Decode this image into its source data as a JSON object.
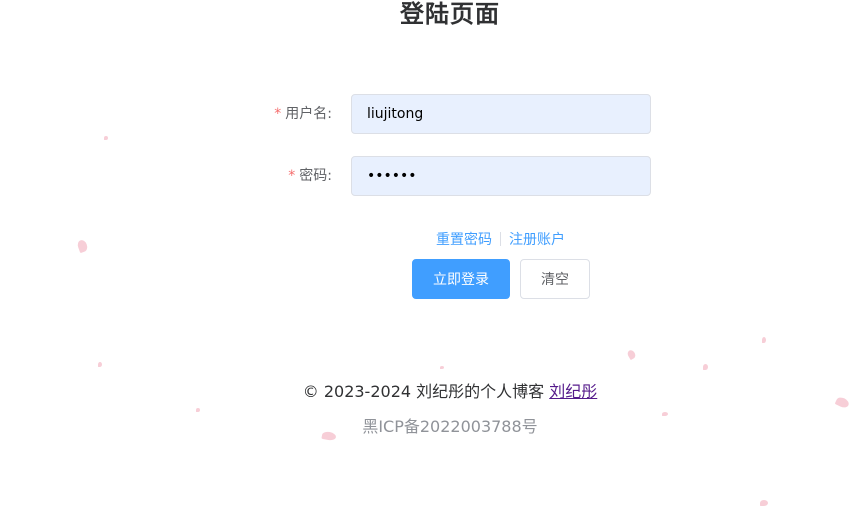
{
  "page": {
    "title": "登陆页面"
  },
  "form": {
    "username": {
      "required_mark": "*",
      "label": "用户名:",
      "value": "liujitong"
    },
    "password": {
      "required_mark": "*",
      "label": "密码:",
      "value": "liujit"
    }
  },
  "links": {
    "reset_password": "重置密码",
    "register": "注册账户"
  },
  "buttons": {
    "login": "立即登录",
    "clear": "清空"
  },
  "footer": {
    "copyright_text": "© 2023-2024 刘纪彤的个人博客 ",
    "author_link": "刘纪彤",
    "icp": "黑ICP备2022003788号"
  },
  "colors": {
    "primary": "#409eff",
    "required": "#f56c6c",
    "input_autofill_bg": "#e8f0fe",
    "petal": "#f6c6d0"
  }
}
